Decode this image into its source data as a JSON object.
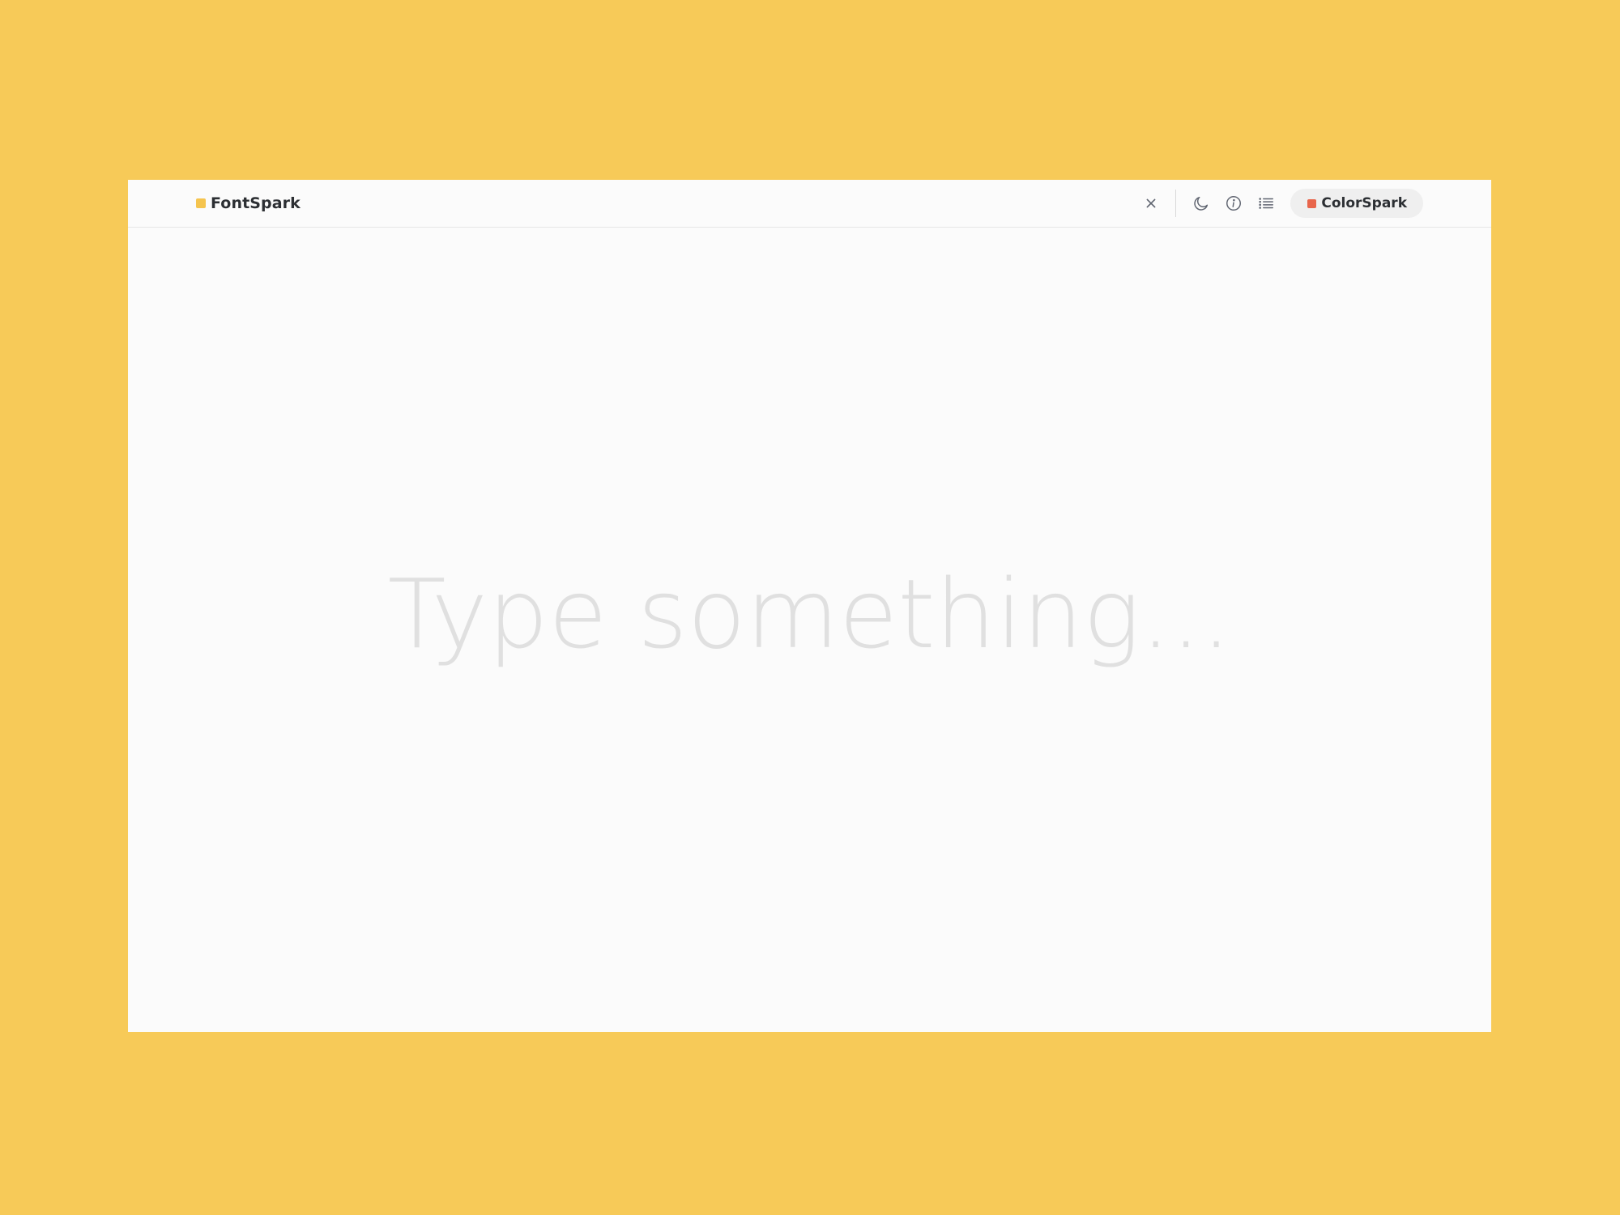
{
  "app": {
    "brand_name": "FontSpark",
    "brand_color": "#F5C44E",
    "background_color": "#F7CA58"
  },
  "toolbar": {
    "icons": [
      "close-icon",
      "moon-icon",
      "info-icon",
      "list-icon"
    ],
    "colorspark": {
      "label": "ColorSpark",
      "swatch_color": "#E8654B"
    }
  },
  "editor": {
    "value": "",
    "placeholder": "Type something..."
  }
}
